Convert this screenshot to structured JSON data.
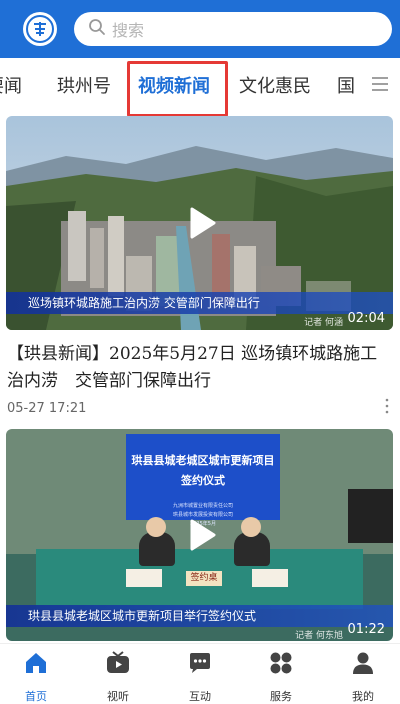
{
  "header": {
    "logo_icon": "county-emblem-icon",
    "search_placeholder": "搜索"
  },
  "tabs": [
    {
      "label": "要闻",
      "active": false
    },
    {
      "label": "珙州号",
      "active": false
    },
    {
      "label": "视频新闻",
      "active": true
    },
    {
      "label": "文化惠民",
      "active": false
    },
    {
      "label": "国",
      "active": false
    }
  ],
  "articles": [
    {
      "caption": "巡场镇环城路施工治内涝   交管部门保障出行",
      "watermark": "记者 何涵",
      "duration": "02:04",
      "title": "【珙县新闻】2025年5月27日 巡场镇环城路施工治内涝　交管部门保障出行",
      "time": "05-27 17:21"
    },
    {
      "banner_line1": "珙县县城老城区城市更新项目",
      "banner_line2": "签约仪式",
      "banner_sub1": "九洲市城置业有限责任公司",
      "banner_sub2": "珙县城市发展投资有限公司",
      "banner_date": "2025年5月",
      "sign_desk": "签约桌",
      "caption": "珙县县城老城区城市更新项目举行签约仪式",
      "watermark": "记者 何东旭",
      "duration": "01:22"
    }
  ],
  "bottom_nav": [
    {
      "label": "首页",
      "icon": "home-icon",
      "active": true
    },
    {
      "label": "视听",
      "icon": "tv-icon",
      "active": false
    },
    {
      "label": "互动",
      "icon": "chat-icon",
      "active": false
    },
    {
      "label": "服务",
      "icon": "grid-icon",
      "active": false
    },
    {
      "label": "我的",
      "icon": "user-icon",
      "active": false
    }
  ],
  "colors": {
    "brand": "#1f6fd6",
    "highlight": "#e53935"
  }
}
